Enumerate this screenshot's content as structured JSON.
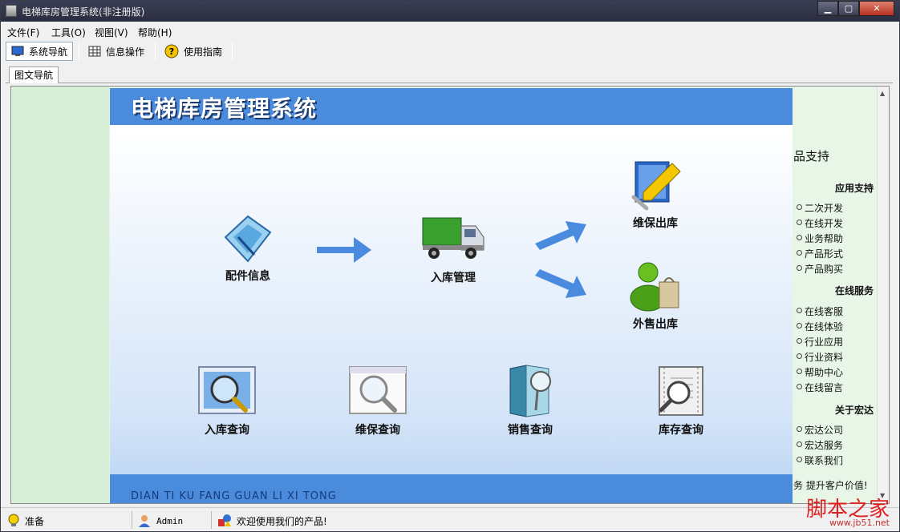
{
  "window": {
    "title": "电梯库房管理系统(非注册版)",
    "min": "▁",
    "max": "▢",
    "close": "✕"
  },
  "menu": [
    {
      "label": "文件(F)"
    },
    {
      "label": "工具(O)"
    },
    {
      "label": "视图(V)"
    },
    {
      "label": "帮助(H)"
    }
  ],
  "toolbar": [
    {
      "label": "系统导航",
      "icon": "monitor-icon"
    },
    {
      "label": "信息操作",
      "icon": "grid-icon"
    },
    {
      "label": "使用指南",
      "icon": "help-icon"
    }
  ],
  "tab": {
    "label": "图文导航"
  },
  "banner": {
    "title": "电梯库房管理系统",
    "pinyin": "DIAN TI KU FANG GUAN LI XI TONG"
  },
  "flow": {
    "parts": "配件信息",
    "stock_in": "入库管理",
    "maintenance_out": "维保出库",
    "sale_out": "外售出库",
    "query_in": "入库查询",
    "query_maint": "维保查询",
    "query_sale": "销售查询",
    "query_stock": "库存查询"
  },
  "right": {
    "title": "品支持",
    "sections": [
      {
        "heading": "应用支持",
        "items": [
          "二次开发",
          "在线开发",
          "业务帮助",
          "产品形式",
          "产品购买"
        ]
      },
      {
        "heading": "在线服务",
        "items": [
          "在线客服",
          "在线体验",
          "行业应用",
          "行业资料",
          "帮助中心",
          "在线留言"
        ]
      },
      {
        "heading": "关于宏达",
        "items": [
          "宏达公司",
          "宏达服务",
          "联系我们"
        ]
      }
    ],
    "footer": "务  提升客户价值!"
  },
  "status": {
    "ready": "准备",
    "user": "Admin",
    "welcome": "欢迎使用我们的产品!"
  },
  "watermark": {
    "text": "脚本之家",
    "url": "www.jb51.net"
  },
  "colors": {
    "banner": "#4a8bdc",
    "arrow": "#4a8be0"
  }
}
